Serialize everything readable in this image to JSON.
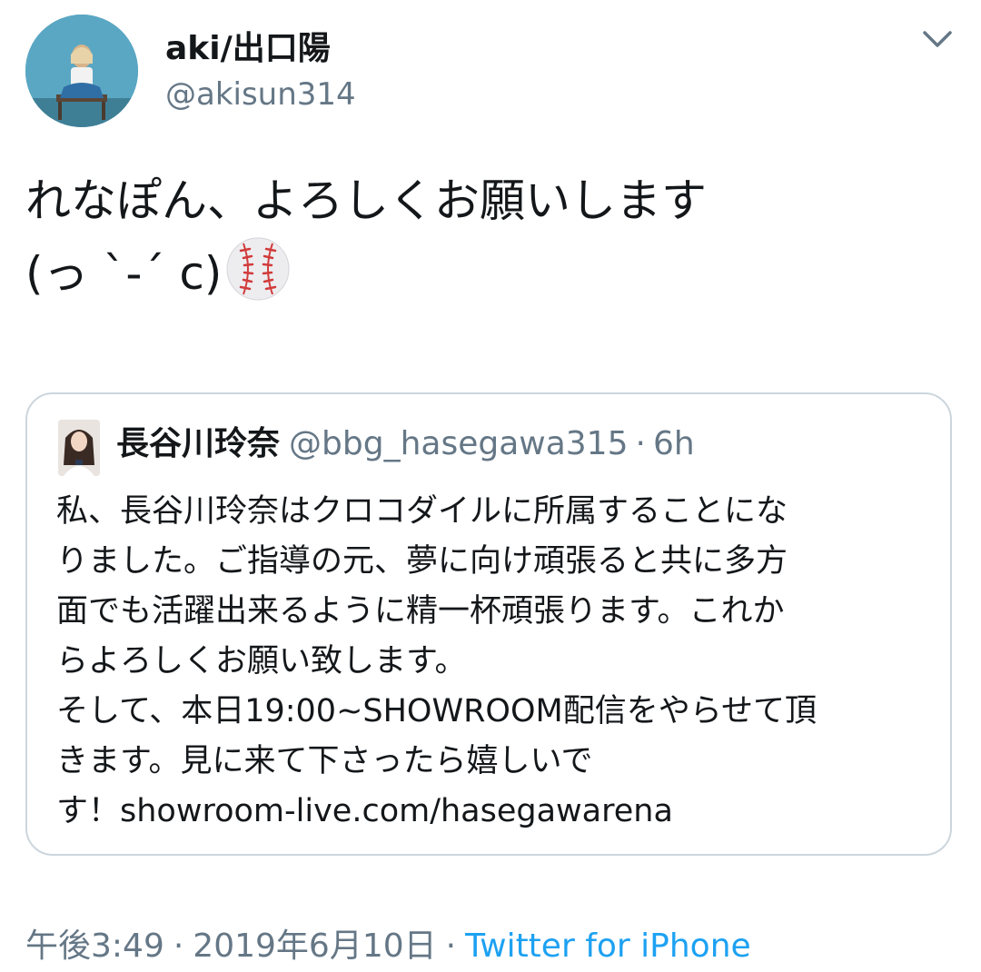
{
  "author": {
    "display_name": "aki/出口陽",
    "handle": "@akisun314",
    "avatar_icon": "profile-photo-avatar"
  },
  "tweet": {
    "lines": [
      "れなぽん、よろしくお願いします",
      "(っ ˋ-ˊ c)"
    ],
    "emoji_icon": "baseball-icon"
  },
  "quote": {
    "display_name": "長谷川玲奈",
    "handle": "@bbg_hasegawa315",
    "separator": "·",
    "time": "6h",
    "body_lines": [
      "私、長谷川玲奈はクロコダイルに所属することにな",
      "りました。ご指導の元、夢に向け頑張ると共に多方",
      "面でも活躍出来るように精一杯頑張ります。これか",
      "らよろしくお願い致します。",
      "そして、本日19:00~SHOWROOM配信をやらせて頂",
      "きます。見に来て下さったら嬉しいで",
      "す！showroom-live.com/hasegawarena"
    ]
  },
  "meta": {
    "time": "午後3:49",
    "separator": "·",
    "date": "2019年6月10日",
    "source": "Twitter for iPhone"
  },
  "colors": {
    "text": "#14171a",
    "secondary": "#657786",
    "link": "#1da1f2",
    "border": "#ccd6dd"
  }
}
